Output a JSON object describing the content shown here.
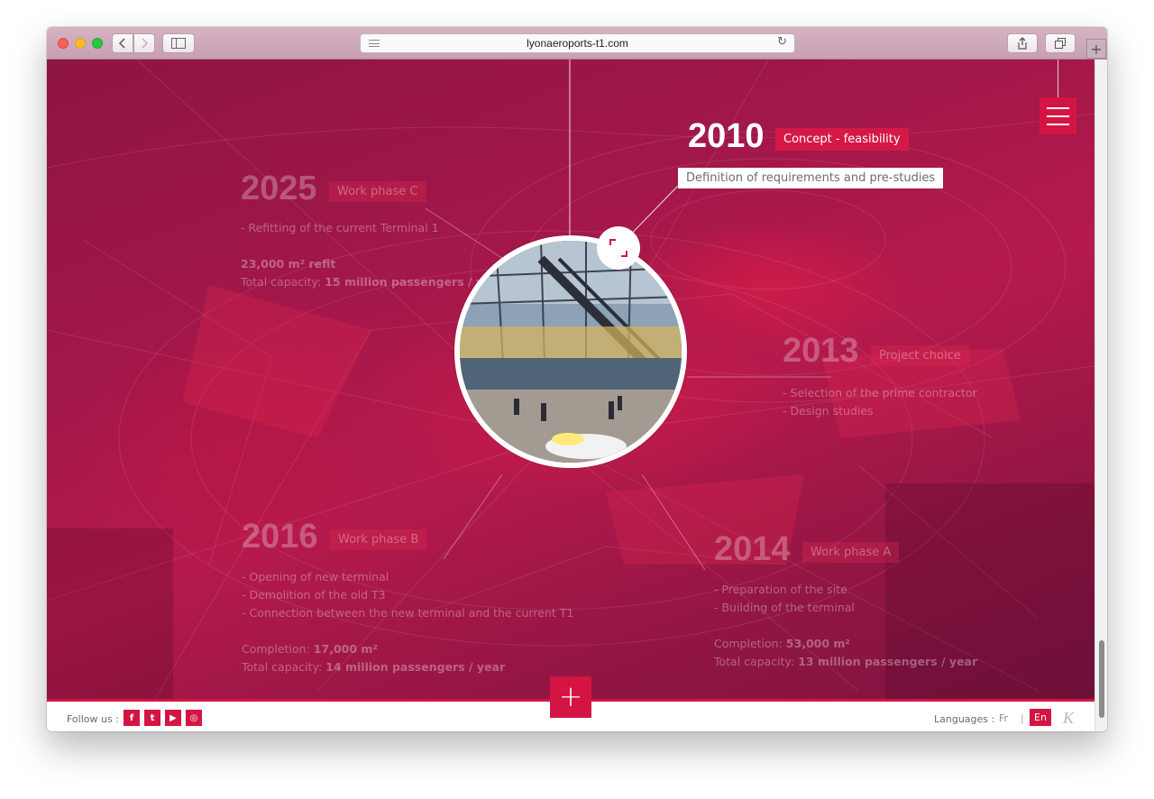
{
  "browser": {
    "url": "lyonaeroports-t1.com"
  },
  "timeline": {
    "active": {
      "year": "2010",
      "phase": "Concept - feasibility",
      "description": "Definition of requirements and pre-studies"
    },
    "y2025": {
      "year": "2025",
      "phase": "Work phase C",
      "line1": "- Refitting of the current Terminal 1",
      "refit": "23,000 m² refit",
      "capacity_label": "Total capacity:",
      "capacity_value": "15 million passengers / year"
    },
    "y2013": {
      "year": "2013",
      "phase": "Project choice",
      "line1": "- Selection of the prime contractor",
      "line2": "- Design studies"
    },
    "y2016": {
      "year": "2016",
      "phase": "Work phase B",
      "line1": "- Opening of new terminal",
      "line2": "- Demolition of the old T3",
      "line3": "- Connection between the new terminal and the current T1",
      "completion_label": "Completion:",
      "completion_value": "17,000 m²",
      "capacity_label": "Total capacity:",
      "capacity_value": "14 million passengers / year"
    },
    "y2014": {
      "year": "2014",
      "phase": "Work phase A",
      "line1": "- Preparation of the site",
      "line2": "- Building of the terminal",
      "completion_label": "Completion:",
      "completion_value": "53,000 m²",
      "capacity_label": "Total capacity:",
      "capacity_value": "13 million passengers / year"
    }
  },
  "footer": {
    "follow_label": "Follow us :",
    "social": [
      "f",
      "t",
      "▶",
      "◎"
    ],
    "languages_label": "Languages :",
    "lang_fr": "Fr",
    "lang_sep": "|",
    "lang_en": "En",
    "logo": "K"
  },
  "plus_label": "+",
  "colors": {
    "accent": "#d41543",
    "background": "#a4174a"
  }
}
